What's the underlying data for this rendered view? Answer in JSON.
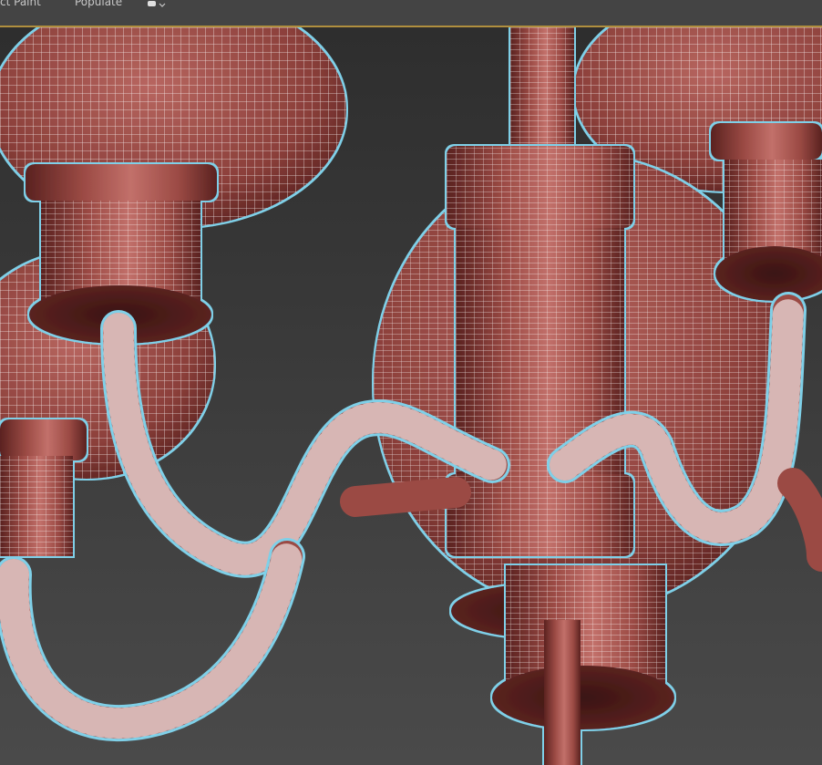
{
  "toolbar": {
    "items": [
      {
        "label": "ct Paint"
      },
      {
        "label": "Populate"
      }
    ],
    "icon": "teapot-dropdown-icon"
  },
  "viewport": {
    "model": "chandelier-wireframe-mesh",
    "colors": {
      "background_top": "#2e2e2e",
      "background_bottom": "#4a4a4a",
      "mesh_base": "#9b4a44",
      "mesh_highlight": "#c2706a",
      "mesh_shadow": "#5a2220",
      "wire": "#ffffff",
      "selection_glow": "#7fd0e8",
      "toolbar_bg": "#444444",
      "toolbar_border": "#b08f3e"
    }
  }
}
